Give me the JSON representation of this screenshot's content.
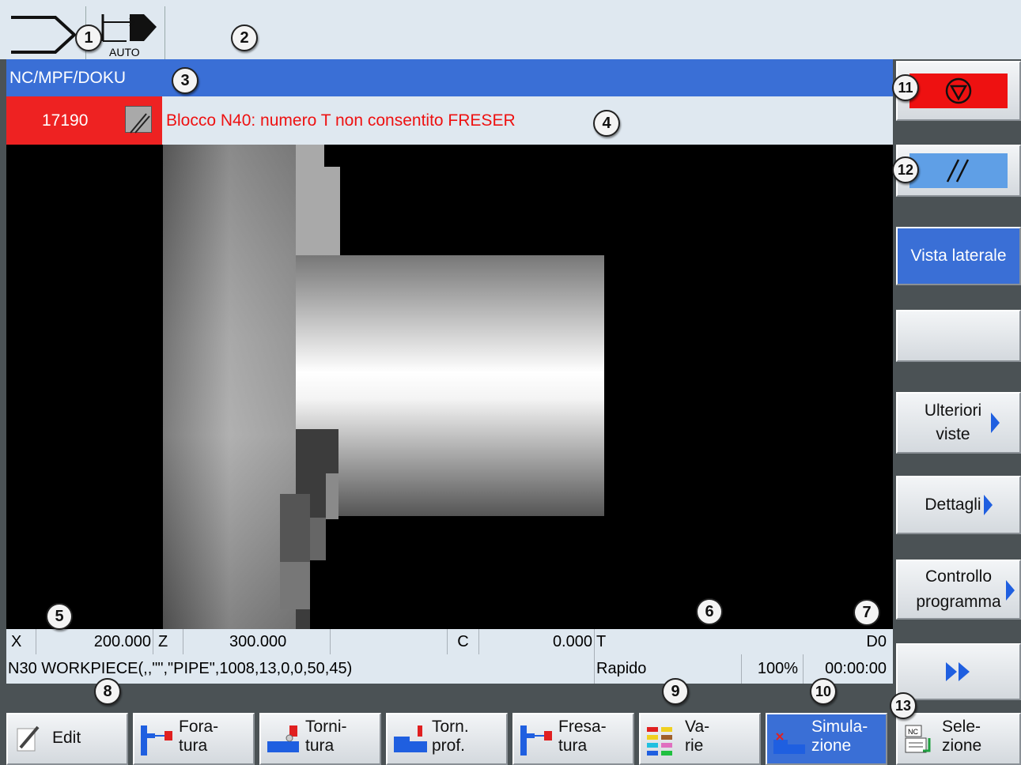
{
  "header": {
    "mode_label": "AUTO",
    "path": "NC/MPF/DOKU"
  },
  "alarm": {
    "number": "17190",
    "text": "Blocco N40: numero T non consentito FRESER"
  },
  "coords": {
    "x_label": "X",
    "x_value": "200.000",
    "z_label": "Z",
    "z_value": "300.000",
    "c_label": "C",
    "c_value": "0.000",
    "t_label": "T",
    "d_label": "D0"
  },
  "block": {
    "text": "N30 WORKPIECE(,,\"\",\"PIPE\",1008,13,0,0,50,45)",
    "feed_mode": "Rapido",
    "override": "100%",
    "time": "00:00:00"
  },
  "right_softkeys": {
    "vista_laterale": "Vista laterale",
    "ulteriori_viste": "Ulteriori viste",
    "dettagli": "Dettagli",
    "controllo_programma": "Controllo programma"
  },
  "bottom_softkeys": {
    "edit": "Edit",
    "foratura": "Fora-\ntura",
    "tornitura": "Torni-\ntura",
    "torn_prof": "Torn.\nprof.",
    "fresatura": "Fresa-\ntura",
    "varie": "Va-\nrie",
    "simulazione": "Simula-\nzione",
    "selezione": "Sele-\nzione"
  },
  "annotations": [
    "1",
    "2",
    "3",
    "4",
    "5",
    "6",
    "7",
    "8",
    "9",
    "10",
    "11",
    "12",
    "13"
  ],
  "colors": {
    "alarm_red": "#ee2222",
    "path_blue": "#3a6fd6",
    "panel": "#dfe8f0"
  }
}
